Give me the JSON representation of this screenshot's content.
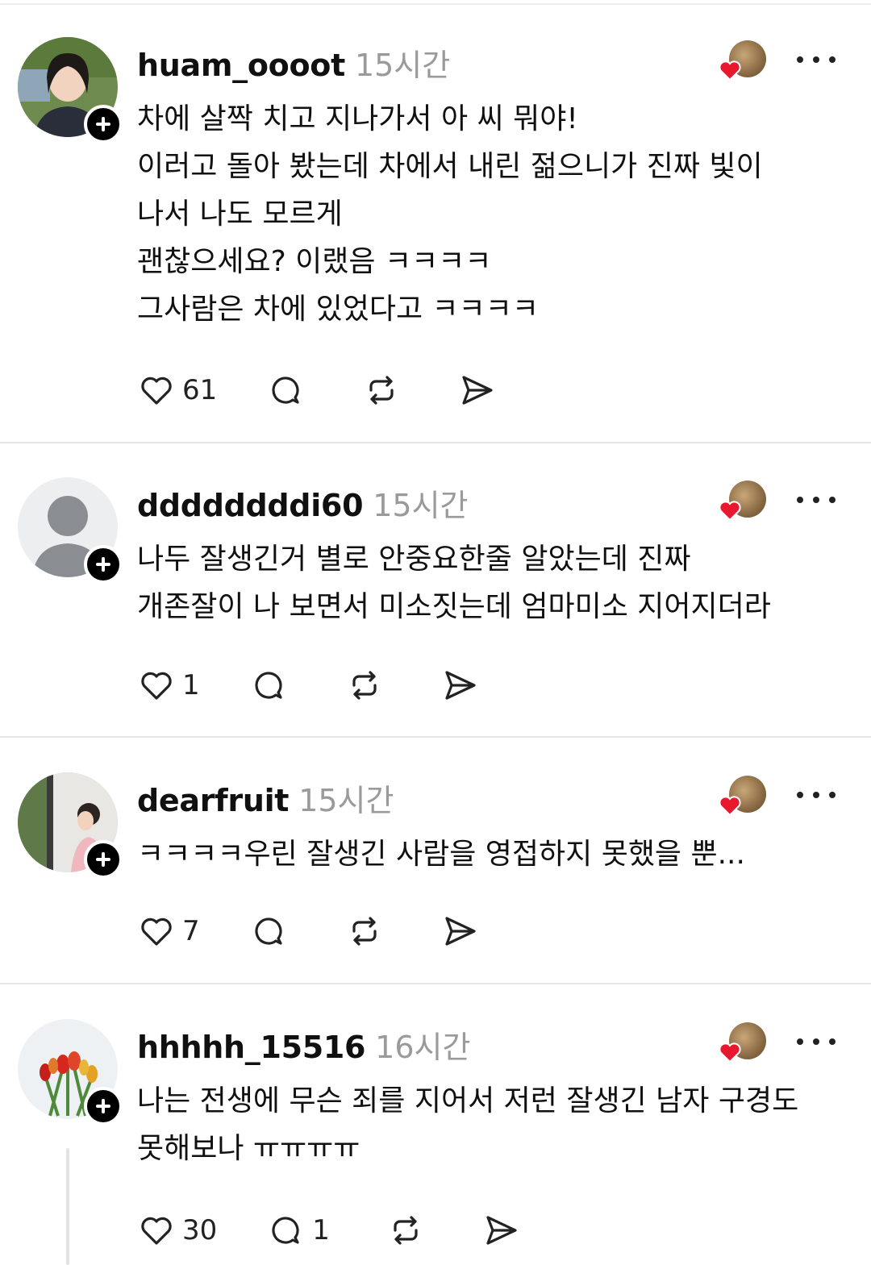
{
  "colors": {
    "like_heart": "#e8192f",
    "text": "#101010",
    "muted": "#9a9a9a",
    "divider": "#e6e6e6"
  },
  "icons": {
    "like": "heart-icon",
    "reply": "comment-icon",
    "repost": "repost-icon",
    "share": "send-icon",
    "more": "more-icon",
    "follow": "plus-icon"
  },
  "posts": [
    {
      "username": "huam_oooot",
      "time": "15시간",
      "text": "차에 살짝 치고 지나가서 아 씨 뭐야!\n이러고 돌아 봤는데 차에서 내린 젊으니가 진짜 빛이\n나서 나도 모르게\n괜찮으세요? 이랬음 ㅋㅋㅋㅋ\n그사람은 차에 있었다고 ㅋㅋㅋㅋ",
      "likes": "61",
      "replies": ""
    },
    {
      "username": "ddddddddi60",
      "time": "15시간",
      "text": "나두 잘생긴거 별로 안중요한줄 알았는데 진짜\n개존잘이 나 보면서 미소짓는데 엄마미소 지어지더라",
      "likes": "1",
      "replies": ""
    },
    {
      "username": "dearfruit",
      "time": "15시간",
      "text": "ㅋㅋㅋㅋ우린 잘생긴 사람을 영접하지 못했을 뿐...",
      "likes": "7",
      "replies": ""
    },
    {
      "username": "hhhhh_15516",
      "time": "16시간",
      "text": "나는 전생에 무슨 죄를 지어서 저런 잘생긴 남자 구경도\n못해보나 ㅠㅠㅠㅠ",
      "likes": "30",
      "replies": "1"
    }
  ]
}
